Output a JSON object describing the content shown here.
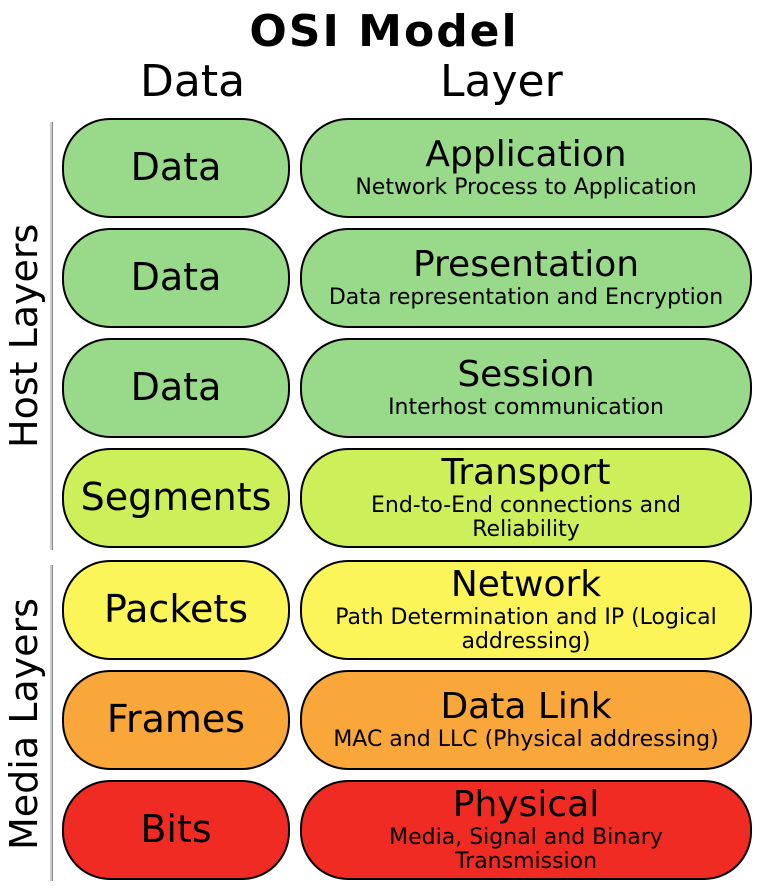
{
  "title": "OSI  Model",
  "columns": {
    "data": "Data",
    "layer": "Layer"
  },
  "groups": {
    "host": {
      "label": "Host Layers"
    },
    "media": {
      "label": "Media Layers"
    }
  },
  "rows": [
    {
      "data_unit": "Data",
      "layer": "Application",
      "desc": "Network Process to Application",
      "color": "c-green"
    },
    {
      "data_unit": "Data",
      "layer": "Presentation",
      "desc": "Data representation and Encryption",
      "color": "c-green"
    },
    {
      "data_unit": "Data",
      "layer": "Session",
      "desc": "Interhost communication",
      "color": "c-green"
    },
    {
      "data_unit": "Segments",
      "layer": "Transport",
      "desc": "End-to-End connections and Reliability",
      "color": "c-lime"
    },
    {
      "data_unit": "Packets",
      "layer": "Network",
      "desc": "Path Determination and IP (Logical addressing)",
      "color": "c-yellow"
    },
    {
      "data_unit": "Frames",
      "layer": "Data Link",
      "desc": "MAC and LLC (Physical addressing)",
      "color": "c-orange"
    },
    {
      "data_unit": "Bits",
      "layer": "Physical",
      "desc": "Media, Signal and Binary Transmission",
      "color": "c-red"
    }
  ]
}
